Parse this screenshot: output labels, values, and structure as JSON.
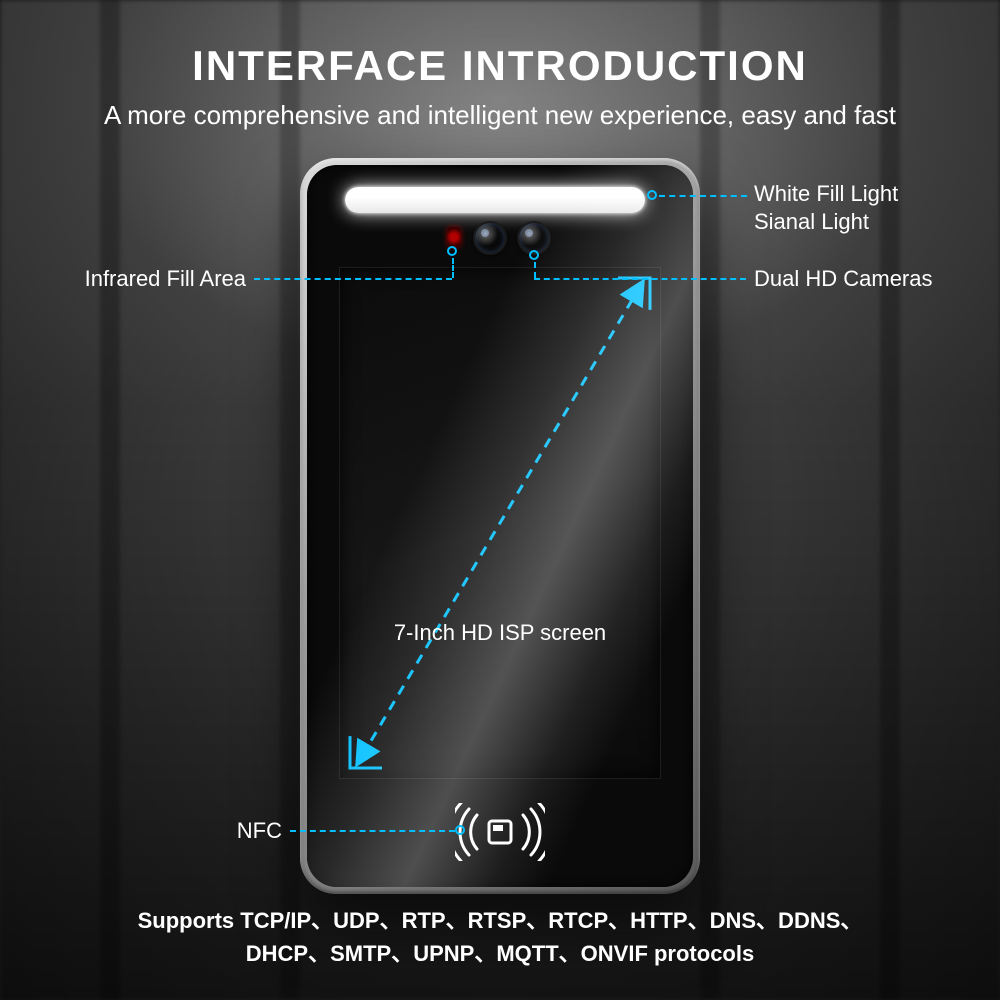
{
  "title": "INTERFACE INTRODUCTION",
  "subtitle": "A more comprehensive and intelligent new experience, easy and fast",
  "callouts": {
    "fill_light_line1": "White Fill Light",
    "fill_light_line2": "Sianal Light",
    "ir_area": "Infrared Fill Area",
    "dual_cameras": "Dual HD Cameras",
    "nfc": "NFC"
  },
  "screen_label": "7-Inch HD ISP screen",
  "protocols_line1": "Supports TCP/IP、UDP、RTP、RTSP、RTCP、HTTP、DNS、DDNS、",
  "protocols_line2": "DHCP、SMTP、UPNP、MQTT、ONVIF protocols",
  "colors": {
    "accent": "#00bfff"
  }
}
